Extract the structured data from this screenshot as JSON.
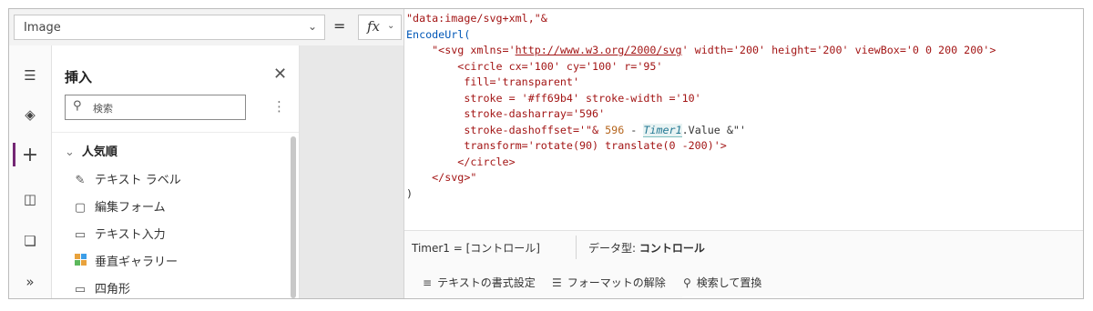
{
  "formula_bar": {
    "property": "Image",
    "equals": "=",
    "fx_label": "fx",
    "code_lines": [
      [
        "\"data:image/svg+xml,\"&"
      ],
      [
        "EncodeUrl("
      ],
      [
        "    \"<svg xmlns='",
        "http://www.w3.org/2000/svg",
        "' width='200' height='200' viewBox='0 0 200 200'>"
      ],
      [
        "        <circle cx='100' cy='100' r='95'"
      ],
      [
        "         fill='transparent'"
      ],
      [
        "         stroke = '#ff69b4' stroke-width ='10'"
      ],
      [
        "         stroke-dasharray='596'"
      ],
      [
        "         stroke-dashoffset='\"& ",
        "596",
        " - ",
        "Timer1",
        ".Value &\"'"
      ],
      [
        "         transform='rotate(90) translate(0 -200)'>"
      ],
      [
        "        </circle>"
      ],
      [
        "    </svg>\""
      ],
      [
        ")"
      ]
    ],
    "status_left": "Timer1 = [コントロール]",
    "status_type_label": "データ型: ",
    "status_type_value": "コントロール",
    "tools": [
      {
        "icon": "text-format-icon",
        "label": "テキストの書式設定"
      },
      {
        "icon": "remove-format-icon",
        "label": "フォーマットの解除"
      },
      {
        "icon": "search-replace-icon",
        "label": "検索して置換"
      }
    ]
  },
  "insert_panel": {
    "title": "挿入",
    "search_placeholder": "検索",
    "category": "人気順",
    "items": [
      {
        "icon": "label-icon",
        "label": "テキスト ラベル"
      },
      {
        "icon": "edit-form-icon",
        "label": "編集フォーム"
      },
      {
        "icon": "text-input-icon",
        "label": "テキスト入力"
      },
      {
        "icon": "gallery-icon",
        "label": "垂直ギャラリー"
      },
      {
        "icon": "rectangle-icon",
        "label": "四角形"
      }
    ]
  },
  "rail": [
    {
      "icon": "hamburger-icon"
    },
    {
      "icon": "layers-icon"
    },
    {
      "icon": "insert-icon",
      "active": true
    },
    {
      "icon": "data-icon"
    },
    {
      "icon": "media-icon"
    },
    {
      "icon": "advanced-tools-icon"
    }
  ]
}
